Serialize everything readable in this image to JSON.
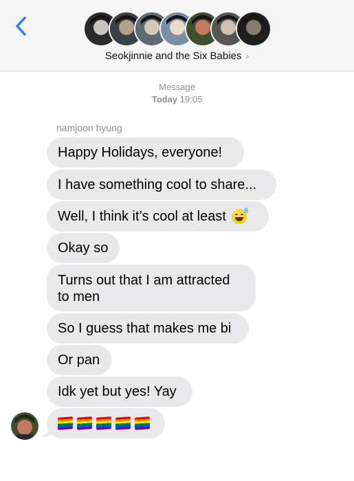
{
  "header": {
    "group_name": "Seokjinnie and the Six Babies",
    "back_icon": "chevron-left-icon",
    "chevron_icon": "chevron-right-icon",
    "accent_color": "#2f7bf6",
    "participants": [
      {
        "avatar_colors": [
          "#2b2b2b",
          "#c9c6c2"
        ]
      },
      {
        "avatar_colors": [
          "#3a3f48",
          "#b59f8a"
        ]
      },
      {
        "avatar_colors": [
          "#5c6b74",
          "#d8c7b6"
        ]
      },
      {
        "avatar_colors": [
          "#7a8ea6",
          "#e9dcc9"
        ]
      },
      {
        "avatar_colors": [
          "#3f4f2e",
          "#c47a62"
        ]
      },
      {
        "avatar_colors": [
          "#565656",
          "#d0c2b3"
        ]
      },
      {
        "avatar_colors": [
          "#1e1e1e",
          "#8a7a6a"
        ]
      }
    ]
  },
  "thread": {
    "service_label": "Message",
    "timestamp_day": "Today",
    "timestamp_time": "19:05",
    "sender_name": "namjoon hyung",
    "messages": [
      {
        "text": "Happy Holidays, everyone!"
      },
      {
        "text": "I have something cool to share..."
      },
      {
        "text": "Well, I think it’s cool at least",
        "emoji": "sweat-smile-emoji"
      },
      {
        "text": "Okay so"
      },
      {
        "text": "Turns out that I am attracted to men"
      },
      {
        "text": "So I guess that makes me bi"
      },
      {
        "text": "Or pan"
      },
      {
        "text": "Idk yet but yes! Yay"
      },
      {
        "text": "",
        "emoji": "rainbow-flag-emoji",
        "emoji_count": 5
      }
    ],
    "bubble_color": "#e9e9eb"
  }
}
